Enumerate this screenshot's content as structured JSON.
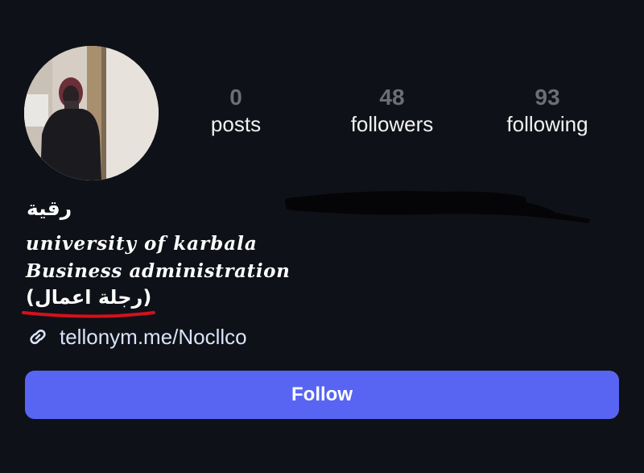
{
  "profile": {
    "name": "رقية",
    "bio_lines": [
      "university of karbala",
      "Business administration",
      "(رجلة اعمال)"
    ],
    "link": {
      "icon": "link-icon",
      "text": "tellonym.me/Nocllco"
    }
  },
  "stats": {
    "posts": {
      "count": "0",
      "label": "posts"
    },
    "followers": {
      "count": "48",
      "label": "followers"
    },
    "following": {
      "count": "93",
      "label": "following"
    }
  },
  "actions": {
    "follow_label": "Follow"
  },
  "colors": {
    "background": "#0f1118",
    "accent_button": "#5865f2",
    "stat_count": "#6b6e76",
    "underline_annotation": "#d4111a",
    "link_text": "#d8e3f8"
  }
}
